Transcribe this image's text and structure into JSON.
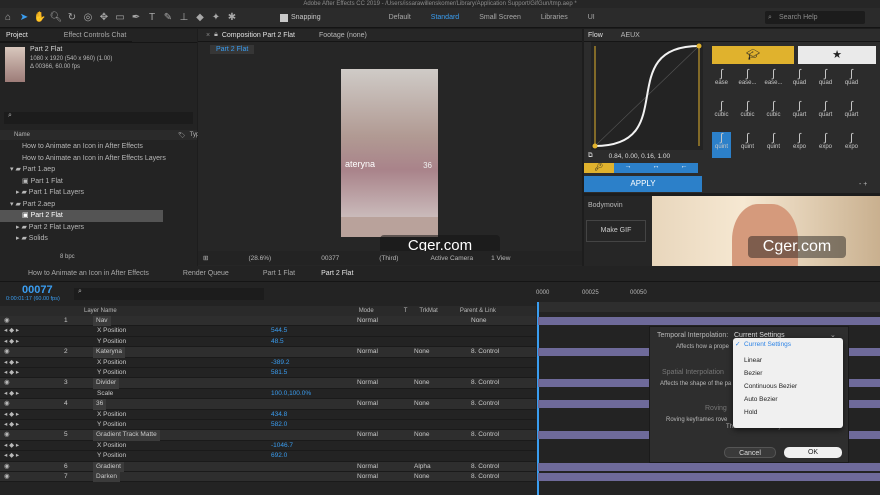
{
  "window_title": "Adobe After Effects CC 2019 - /Users/issarawillenskomer/Library/Application Support/GifGun/tmp.aep *",
  "toolbar": {
    "snapping": "Snapping",
    "workspaces": [
      "Default",
      "Standard",
      "Small Screen",
      "Libraries",
      "UI"
    ],
    "active_workspace": "Standard",
    "search_placeholder": "Search Help"
  },
  "project_panel": {
    "tabs": [
      "Project",
      "Effect Controls Chat"
    ],
    "selected_name": "Part 2 Flat",
    "selected_info1": "1080 x 1920  (540 x 960) (1.00)",
    "selected_info2": "Δ 00366, 60.00 fps",
    "col_name": "Name",
    "col_type": "Type",
    "items": [
      {
        "label": "How to Animate an Icon in After Effects"
      },
      {
        "label": "How to Animate an Icon in After Effects Layers"
      },
      {
        "label": "Part 1.aep"
      },
      {
        "label": "Part 1 Flat"
      },
      {
        "label": "Part 1 Flat Layers"
      },
      {
        "label": "Part 2.aep"
      },
      {
        "label": "Part 2 Flat"
      },
      {
        "label": "Part 2 Flat Layers"
      },
      {
        "label": "Solids"
      }
    ],
    "bpc": "8 bpc"
  },
  "composition": {
    "tab": "Composition Part 2 Flat",
    "footage_tab": "Footage (none)",
    "subtab": "Part 2 Flat",
    "canvas_name": "ateryna",
    "canvas_num": "36",
    "zoom": "(28.6%)",
    "timecode": "00377",
    "resolution": "(Third)",
    "camera": "Active Camera",
    "view": "1 View"
  },
  "watermark": "Cger.com",
  "flow": {
    "tabs": [
      "Flow",
      "AEUX"
    ],
    "values": "0.84, 0.00, 0.16, 1.00",
    "apply": "APPLY",
    "preset_labels": [
      "ease",
      "ease...",
      "ease...",
      "quad",
      "quad",
      "quad",
      "cubic",
      "cubic",
      "cubic",
      "quart",
      "quart",
      "quart",
      "quint",
      "quint",
      "quint",
      "expo",
      "expo",
      "expo"
    ]
  },
  "bodymovin": {
    "label": "Bodymovin",
    "button": "Make GIF"
  },
  "timeline": {
    "tabs": [
      "How to Animate an Icon in After Effects",
      "Render Queue",
      "Part 1 Flat",
      "Part 2 Flat"
    ],
    "timecode": "00077",
    "timecode_sub": "0:00:01:17 (60.00 fps)",
    "headers": {
      "layer_name": "Layer Name",
      "mode": "Mode",
      "t": "T",
      "trkmat": "TrkMat",
      "parent": "Parent & Link"
    },
    "ruler": [
      "0000",
      "00025",
      "00050"
    ],
    "rows": [
      {
        "idx": "1",
        "name": "Nav",
        "val": "",
        "mode": "Normal",
        "trk": "",
        "par": "None",
        "layer": true
      },
      {
        "idx": "",
        "name": "X Position",
        "val": "544.5",
        "mode": "",
        "trk": "",
        "par": "",
        "layer": false
      },
      {
        "idx": "",
        "name": "Y Position",
        "val": "48.5",
        "mode": "",
        "trk": "",
        "par": "",
        "layer": false
      },
      {
        "idx": "2",
        "name": "Kateryna",
        "val": "",
        "mode": "Normal",
        "trk": "None",
        "par": "8. Control",
        "layer": true
      },
      {
        "idx": "",
        "name": "X Position",
        "val": "-389.2",
        "mode": "",
        "trk": "",
        "par": "",
        "layer": false
      },
      {
        "idx": "",
        "name": "Y Position",
        "val": "581.5",
        "mode": "",
        "trk": "",
        "par": "",
        "layer": false
      },
      {
        "idx": "3",
        "name": "Divider",
        "val": "",
        "mode": "Normal",
        "trk": "None",
        "par": "8. Control",
        "layer": true
      },
      {
        "idx": "",
        "name": "Scale",
        "val": "100.0,100.0%",
        "mode": "",
        "trk": "",
        "par": "",
        "layer": false
      },
      {
        "idx": "4",
        "name": "36",
        "val": "",
        "mode": "Normal",
        "trk": "None",
        "par": "8. Control",
        "layer": true
      },
      {
        "idx": "",
        "name": "X Position",
        "val": "434.8",
        "mode": "",
        "trk": "",
        "par": "",
        "layer": false
      },
      {
        "idx": "",
        "name": "Y Position",
        "val": "582.0",
        "mode": "",
        "trk": "",
        "par": "",
        "layer": false
      },
      {
        "idx": "5",
        "name": "Gradient Track Matte",
        "val": "",
        "mode": "Normal",
        "trk": "None",
        "par": "8. Control",
        "layer": true
      },
      {
        "idx": "",
        "name": "X Position",
        "val": "-1046.7",
        "mode": "",
        "trk": "",
        "par": "",
        "layer": false
      },
      {
        "idx": "",
        "name": "Y Position",
        "val": "692.0",
        "mode": "",
        "trk": "",
        "par": "",
        "layer": false
      },
      {
        "idx": "6",
        "name": "Gradient",
        "val": "",
        "mode": "Normal",
        "trk": "Alpha",
        "par": "8. Control",
        "layer": true
      },
      {
        "idx": "7",
        "name": "Darken",
        "val": "",
        "mode": "Normal",
        "trk": "None",
        "par": "8. Control",
        "layer": true
      }
    ]
  },
  "popup": {
    "temporal_label": "Temporal Interpolation:",
    "temporal_value": "Current Settings",
    "affects_temporal": "Affects how a prope",
    "spatial_label": "Spatial Interpolation",
    "affects_spatial": "Affects the shape of the pa",
    "roving_label": "Roving",
    "roving_desc": "Roving keyframes rove",
    "roving_note": "The first and last keyframes cannot rove.",
    "menu": [
      "Current Settings",
      "Linear",
      "Bezier",
      "Continuous Bezier",
      "Auto Bezier",
      "Hold"
    ],
    "cancel": "Cancel",
    "ok": "OK"
  }
}
